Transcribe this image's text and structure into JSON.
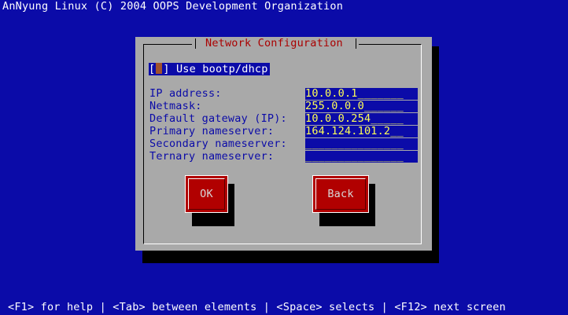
{
  "banner": "AnNyung Linux (C) 2004 OOPS Development Organization",
  "dialog": {
    "title": "Network Configuration",
    "dhcp": {
      "checkbox": "[ ]",
      "label": "Use bootp/dhcp"
    },
    "fields": [
      {
        "label": "IP address:",
        "value": "10.0.0.1_______"
      },
      {
        "label": "Netmask:",
        "value": "255.0.0.0______"
      },
      {
        "label": "Default gateway (IP):",
        "value": "10.0.0.254_____"
      },
      {
        "label": "Primary nameserver:",
        "value": "164.124.101.2__"
      },
      {
        "label": "Secondary nameserver:",
        "value": "_______________"
      },
      {
        "label": "Ternary nameserver:",
        "value": "_______________"
      }
    ],
    "buttons": {
      "ok": "OK",
      "back": "Back"
    }
  },
  "helpline": "<F1> for help | <Tab> between elements | <Space> selects | <F12> next screen",
  "colors": {
    "screen_bg": "#0b0ba8",
    "dialog_bg": "#a9a9a9",
    "title": "#aa0000",
    "field_text": "#ffff55",
    "button_bg": "#b10000"
  }
}
